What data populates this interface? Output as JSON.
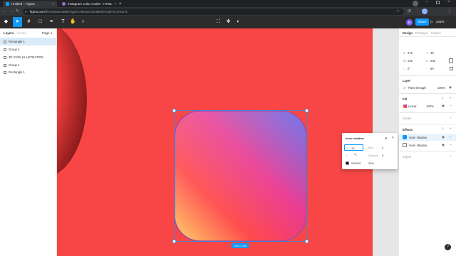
{
  "browser": {
    "tabs": [
      {
        "title": "Untitled – Figma",
        "favicon_color": "#0d99ff"
      },
      {
        "title": "Instagram Color Codes - HTML",
        "favicon_color": "#9b6bd6"
      }
    ],
    "new_tab_label": "+",
    "url_host": "figma.com",
    "url_path": "/file/cDbsZnWaEFhgZAcHbc2EL/Untitled?node-id=0%3A1"
  },
  "toolbar": {
    "share_label": "Share",
    "avatar_initial": "M",
    "zoom_label": "241%"
  },
  "left_panel": {
    "tabs": [
      "Layers",
      "Assets"
    ],
    "page_label": "Page 1",
    "layers": [
      {
        "label": "Rectangle 1",
        "selected": true
      },
      {
        "label": "Group 4",
        "selected": false
      },
      {
        "label": "3D ICON ILLUSTRATION",
        "selected": false
      },
      {
        "label": "Group 1",
        "selected": false
      },
      {
        "label": "Rectangle 1",
        "selected": false
      }
    ]
  },
  "canvas": {
    "background": "#f84646",
    "size_badge": "230 × 230",
    "gradient_colors": [
      "#ffd36a",
      "#ff4a4a",
      "#e8348f",
      "#4f5dec"
    ]
  },
  "effect_popup": {
    "title": "Inner shadow",
    "x_label": "X",
    "x_value": "10",
    "y_label": "Y",
    "blur_label": "Blur",
    "blur_value": "4",
    "spread_label": "Spread",
    "spread_value": "0",
    "color_hex": "000000",
    "color_opacity": "25%"
  },
  "right_panel": {
    "tabs": [
      "Design",
      "Prototype",
      "Inspect"
    ],
    "x_label": "X",
    "x_value": "272",
    "y_label": "Y",
    "y_value": "49",
    "w_label": "W",
    "w_value": "230",
    "h_label": "H",
    "h_value": "230",
    "rotation_value": "0°",
    "radius_value": "50",
    "layer_section": "Layer",
    "blend_mode": "Pass through",
    "layer_opacity": "100%",
    "fill_section": "Fill",
    "fill_type": "Linear",
    "fill_opacity": "100%",
    "stroke_section": "Stroke",
    "effects_section": "Effects",
    "effects": [
      "Inner shadow",
      "Inner shadow"
    ],
    "export_section": "Export"
  }
}
